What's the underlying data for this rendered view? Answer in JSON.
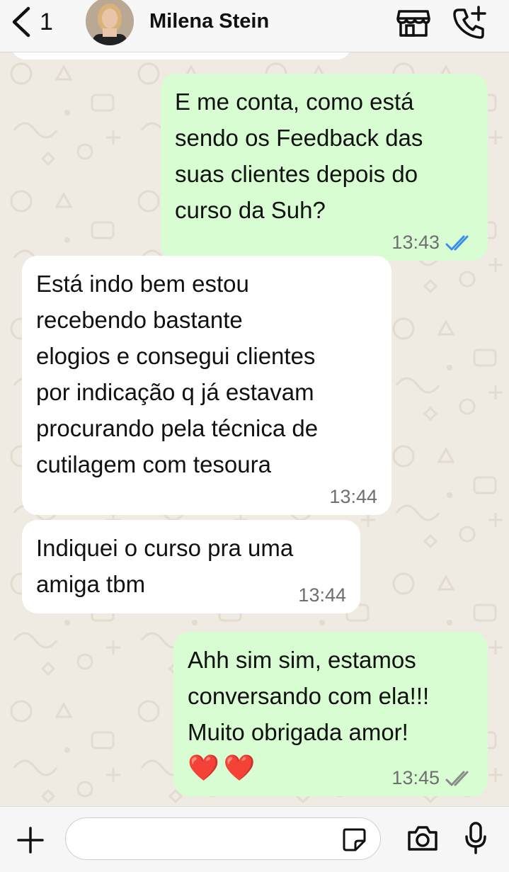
{
  "header": {
    "back_count": "1",
    "contact_name": "Milena Stein"
  },
  "messages": [
    {
      "direction": "out",
      "text": "E me conta, como está\nsendo os Feedback das\nsuas clientes depois do\ncurso da Suh?",
      "time": "13:43",
      "status": "read"
    },
    {
      "direction": "in",
      "text": "Está indo bem estou\nrecebendo bastante\nelogios e consegui clientes\npor indicação q já estavam\nprocurando pela técnica de\ncutilagem com tesoura",
      "time": "13:44"
    },
    {
      "direction": "in",
      "text": "Indiquei o curso pra uma\namiga tbm",
      "time": "13:44"
    },
    {
      "direction": "out",
      "text": "Ahh sim sim, estamos\nconversando com ela!!!\nMuito obrigada amor!",
      "emoji": "❤️❤️",
      "time": "13:45",
      "status": "delivered"
    }
  ],
  "composer": {
    "placeholder": ""
  },
  "colors": {
    "outgoing_bubble": "#d9fdd3",
    "incoming_bubble": "#ffffff",
    "read_ticks": "#3b8ee8",
    "delivered_ticks": "#8a8a8a",
    "wallpaper": "#efeae2"
  }
}
